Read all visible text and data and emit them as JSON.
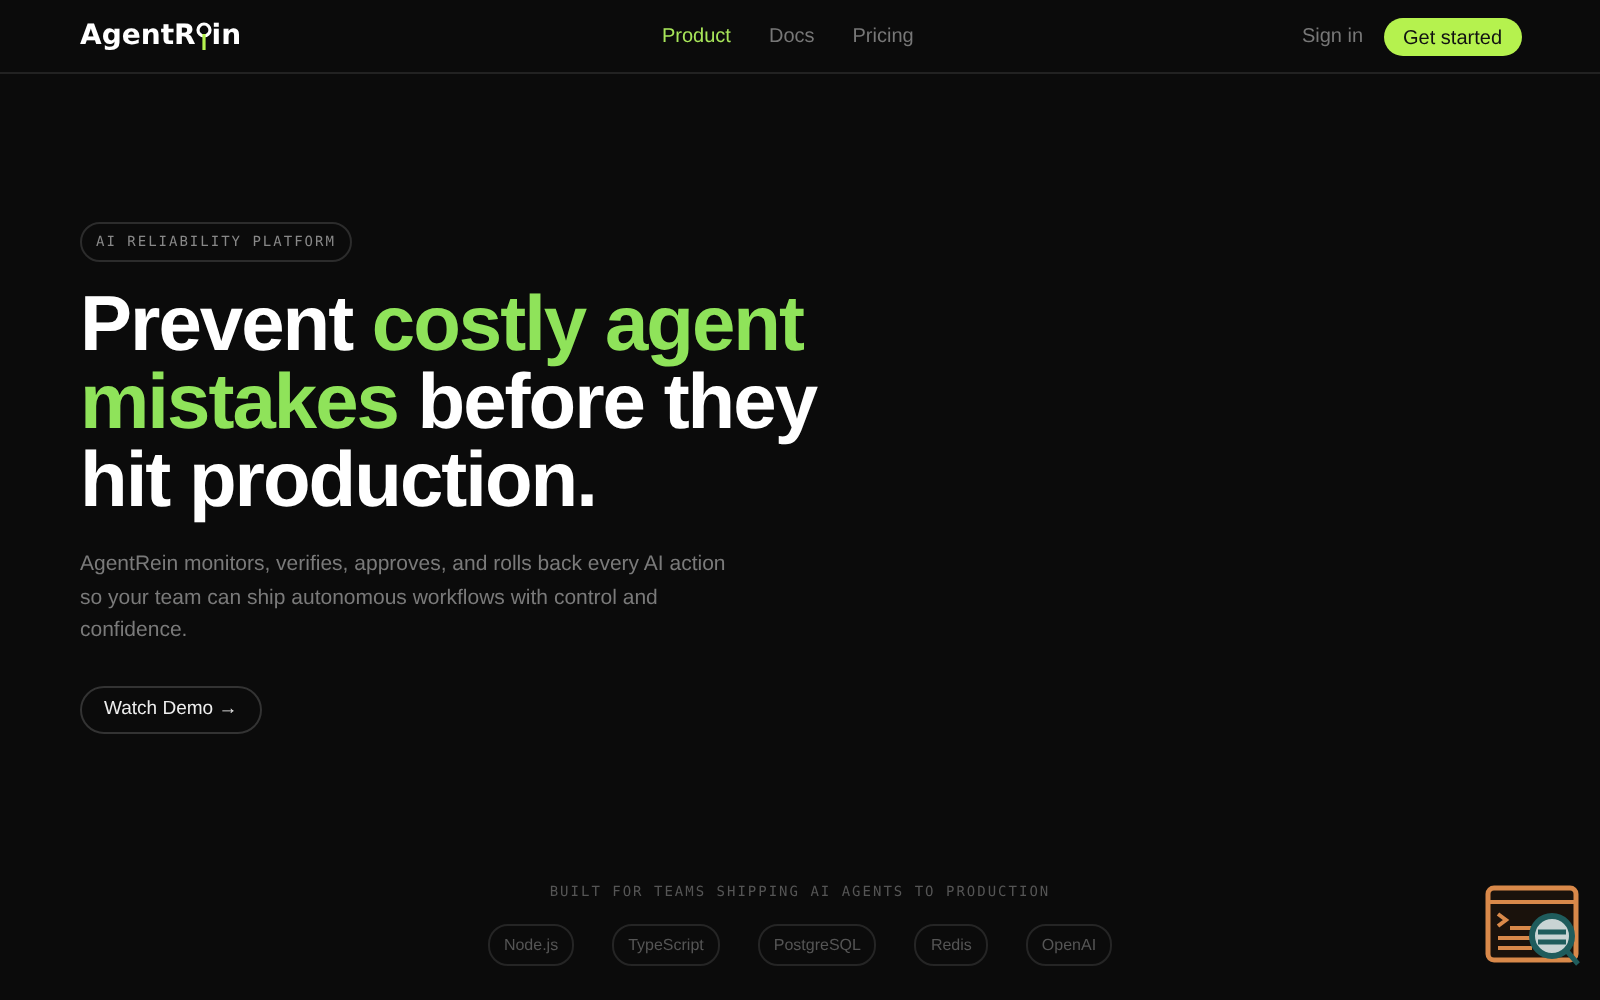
{
  "logo": {
    "before": "AgentR",
    "after": "in"
  },
  "nav": [
    {
      "label": "Product",
      "selected": true
    },
    {
      "label": "Docs",
      "selected": false
    },
    {
      "label": "Pricing",
      "selected": false
    }
  ],
  "sign_in": "Sign in",
  "cta": "Get started",
  "hero": {
    "badge": "AI RELIABILITY PLATFORM",
    "headline": [
      {
        "text": "Prevent ",
        "accent": false
      },
      {
        "text": "costly agent mistakes",
        "accent": true
      },
      {
        "text": " before they hit production.",
        "accent": false
      }
    ],
    "description": "AgentRein monitors, verifies, approves, and rolls back every AI action so your team can ship autonomous workflows with control and confidence.",
    "button": "Watch Demo →"
  },
  "built_for": {
    "title": "BUILT FOR TEAMS SHIPPING AI AGENTS TO PRODUCTION",
    "tags": [
      "Node.js",
      "TypeScript",
      "PostgreSQL",
      "Redis",
      "OpenAI"
    ]
  }
}
